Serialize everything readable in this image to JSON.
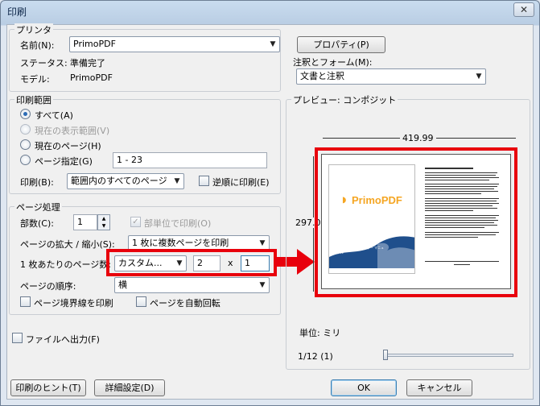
{
  "window": {
    "title": "印刷",
    "close_glyph": "✕"
  },
  "printer": {
    "group_label": "プリンタ",
    "name_label": "名前(N):",
    "name_value": "PrimoPDF",
    "properties_button": "プロパティ(P)",
    "status_label": "ステータス:",
    "status_value": "準備完了",
    "model_label": "モデル:",
    "model_value": "PrimoPDF",
    "notes_label": "注釈とフォーム(M):",
    "notes_value": "文書と注釈"
  },
  "range": {
    "group_label": "印刷範囲",
    "options": [
      "すべて(A)",
      "現在の表示範囲(V)",
      "現在のページ(H)",
      "ページ指定(G)"
    ],
    "pages_value": "1 - 23",
    "print_label": "印刷(B):",
    "print_value": "範囲内のすべてのページ",
    "reverse_label": "逆順に印刷(E)"
  },
  "handling": {
    "group_label": "ページ処理",
    "copies_label": "部数(C):",
    "copies_value": "1",
    "collate_label": "部単位で印刷(O)",
    "scaling_label": "ページの拡大 / 縮小(S):",
    "scaling_value": "1 枚に複数ページを印刷",
    "pages_per_sheet_label": "1 枚あたりのページ数:",
    "pages_per_sheet_value": "カスタム...",
    "cols_value": "2",
    "times_glyph": "x",
    "rows_value": "1",
    "order_label": "ページの順序:",
    "order_value": "横",
    "border_label": "ページ境界線を印刷",
    "autorotate_label": "ページを自動回転"
  },
  "file_output_label": "ファイルへ出力(F)",
  "preview": {
    "group_label": "プレビュー: コンポジット",
    "width_value": "419.99",
    "height_value": "297.0",
    "unit_label": "単位: ミリ",
    "page_counter": "1/12 (1)",
    "slider_position": 0,
    "thumb_brand": "PrimoPDF",
    "thumb_subtitle": "バージョン 4.1 ユーザー マニュアル"
  },
  "buttons": {
    "tips": "印刷のヒント(T)",
    "advanced": "詳細設定(D)",
    "ok": "OK",
    "cancel": "キャンセル"
  },
  "colors": {
    "highlight_red": "#e8000c",
    "brand_orange": "#f5a623",
    "brand_blue": "#1f4f8c"
  }
}
